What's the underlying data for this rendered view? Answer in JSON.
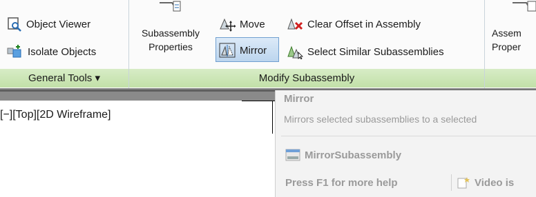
{
  "ribbon": {
    "general_tools": {
      "object_viewer": "Object Viewer",
      "isolate_objects": "Isolate Objects",
      "footer": "General Tools ▾"
    },
    "modify_subassembly": {
      "subassembly_properties_line1": "Subassembly",
      "subassembly_properties_line2": "Properties",
      "move": "Move",
      "mirror": "Mirror",
      "clear_offset": "Clear Offset in Assembly",
      "select_similar": "Select Similar Subassemblies",
      "footer": "Modify Subassembly"
    },
    "assembly": {
      "assembly_properties_line1": "Assem",
      "assembly_properties_line2": "Proper"
    }
  },
  "viewport": {
    "label": "[−][Top][2D Wireframe]"
  },
  "tooltip": {
    "title": "Mirror",
    "description": "Mirrors selected subassemblies to a selected",
    "command": "MirrorSubassembly",
    "help": "Press F1 for more help",
    "video": "Video is"
  },
  "colors": {
    "panel_footer": "#c8e3b0",
    "active_button": "#bcd5ee",
    "tooltip_bg": "#f3f3f3",
    "tooltip_text": "#9a9a9a"
  }
}
